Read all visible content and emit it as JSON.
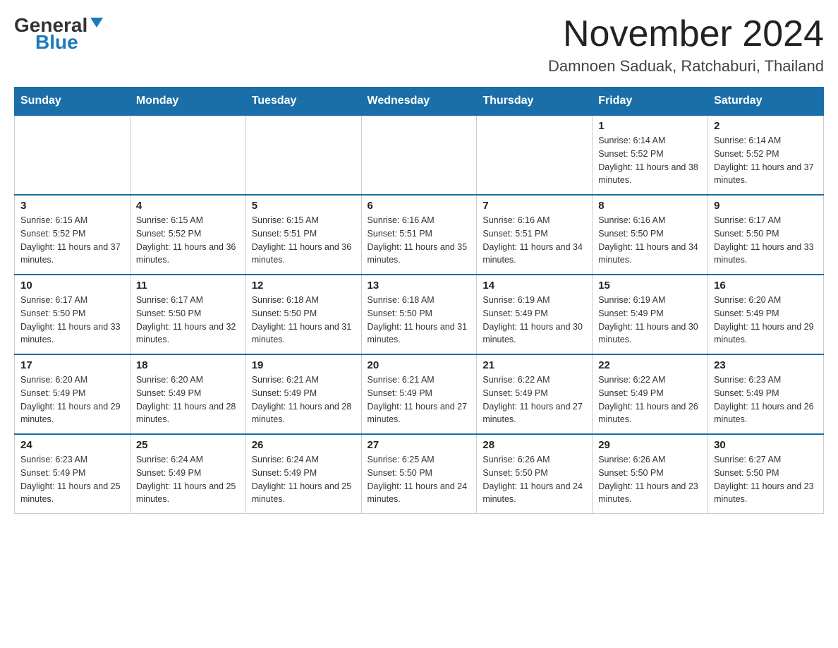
{
  "header": {
    "logo_general": "General",
    "logo_blue": "Blue",
    "month_title": "November 2024",
    "location": "Damnoen Saduak, Ratchaburi, Thailand"
  },
  "days_of_week": [
    "Sunday",
    "Monday",
    "Tuesday",
    "Wednesday",
    "Thursday",
    "Friday",
    "Saturday"
  ],
  "weeks": [
    [
      {
        "day": "",
        "info": ""
      },
      {
        "day": "",
        "info": ""
      },
      {
        "day": "",
        "info": ""
      },
      {
        "day": "",
        "info": ""
      },
      {
        "day": "",
        "info": ""
      },
      {
        "day": "1",
        "info": "Sunrise: 6:14 AM\nSunset: 5:52 PM\nDaylight: 11 hours and 38 minutes."
      },
      {
        "day": "2",
        "info": "Sunrise: 6:14 AM\nSunset: 5:52 PM\nDaylight: 11 hours and 37 minutes."
      }
    ],
    [
      {
        "day": "3",
        "info": "Sunrise: 6:15 AM\nSunset: 5:52 PM\nDaylight: 11 hours and 37 minutes."
      },
      {
        "day": "4",
        "info": "Sunrise: 6:15 AM\nSunset: 5:52 PM\nDaylight: 11 hours and 36 minutes."
      },
      {
        "day": "5",
        "info": "Sunrise: 6:15 AM\nSunset: 5:51 PM\nDaylight: 11 hours and 36 minutes."
      },
      {
        "day": "6",
        "info": "Sunrise: 6:16 AM\nSunset: 5:51 PM\nDaylight: 11 hours and 35 minutes."
      },
      {
        "day": "7",
        "info": "Sunrise: 6:16 AM\nSunset: 5:51 PM\nDaylight: 11 hours and 34 minutes."
      },
      {
        "day": "8",
        "info": "Sunrise: 6:16 AM\nSunset: 5:50 PM\nDaylight: 11 hours and 34 minutes."
      },
      {
        "day": "9",
        "info": "Sunrise: 6:17 AM\nSunset: 5:50 PM\nDaylight: 11 hours and 33 minutes."
      }
    ],
    [
      {
        "day": "10",
        "info": "Sunrise: 6:17 AM\nSunset: 5:50 PM\nDaylight: 11 hours and 33 minutes."
      },
      {
        "day": "11",
        "info": "Sunrise: 6:17 AM\nSunset: 5:50 PM\nDaylight: 11 hours and 32 minutes."
      },
      {
        "day": "12",
        "info": "Sunrise: 6:18 AM\nSunset: 5:50 PM\nDaylight: 11 hours and 31 minutes."
      },
      {
        "day": "13",
        "info": "Sunrise: 6:18 AM\nSunset: 5:50 PM\nDaylight: 11 hours and 31 minutes."
      },
      {
        "day": "14",
        "info": "Sunrise: 6:19 AM\nSunset: 5:49 PM\nDaylight: 11 hours and 30 minutes."
      },
      {
        "day": "15",
        "info": "Sunrise: 6:19 AM\nSunset: 5:49 PM\nDaylight: 11 hours and 30 minutes."
      },
      {
        "day": "16",
        "info": "Sunrise: 6:20 AM\nSunset: 5:49 PM\nDaylight: 11 hours and 29 minutes."
      }
    ],
    [
      {
        "day": "17",
        "info": "Sunrise: 6:20 AM\nSunset: 5:49 PM\nDaylight: 11 hours and 29 minutes."
      },
      {
        "day": "18",
        "info": "Sunrise: 6:20 AM\nSunset: 5:49 PM\nDaylight: 11 hours and 28 minutes."
      },
      {
        "day": "19",
        "info": "Sunrise: 6:21 AM\nSunset: 5:49 PM\nDaylight: 11 hours and 28 minutes."
      },
      {
        "day": "20",
        "info": "Sunrise: 6:21 AM\nSunset: 5:49 PM\nDaylight: 11 hours and 27 minutes."
      },
      {
        "day": "21",
        "info": "Sunrise: 6:22 AM\nSunset: 5:49 PM\nDaylight: 11 hours and 27 minutes."
      },
      {
        "day": "22",
        "info": "Sunrise: 6:22 AM\nSunset: 5:49 PM\nDaylight: 11 hours and 26 minutes."
      },
      {
        "day": "23",
        "info": "Sunrise: 6:23 AM\nSunset: 5:49 PM\nDaylight: 11 hours and 26 minutes."
      }
    ],
    [
      {
        "day": "24",
        "info": "Sunrise: 6:23 AM\nSunset: 5:49 PM\nDaylight: 11 hours and 25 minutes."
      },
      {
        "day": "25",
        "info": "Sunrise: 6:24 AM\nSunset: 5:49 PM\nDaylight: 11 hours and 25 minutes."
      },
      {
        "day": "26",
        "info": "Sunrise: 6:24 AM\nSunset: 5:49 PM\nDaylight: 11 hours and 25 minutes."
      },
      {
        "day": "27",
        "info": "Sunrise: 6:25 AM\nSunset: 5:50 PM\nDaylight: 11 hours and 24 minutes."
      },
      {
        "day": "28",
        "info": "Sunrise: 6:26 AM\nSunset: 5:50 PM\nDaylight: 11 hours and 24 minutes."
      },
      {
        "day": "29",
        "info": "Sunrise: 6:26 AM\nSunset: 5:50 PM\nDaylight: 11 hours and 23 minutes."
      },
      {
        "day": "30",
        "info": "Sunrise: 6:27 AM\nSunset: 5:50 PM\nDaylight: 11 hours and 23 minutes."
      }
    ]
  ]
}
